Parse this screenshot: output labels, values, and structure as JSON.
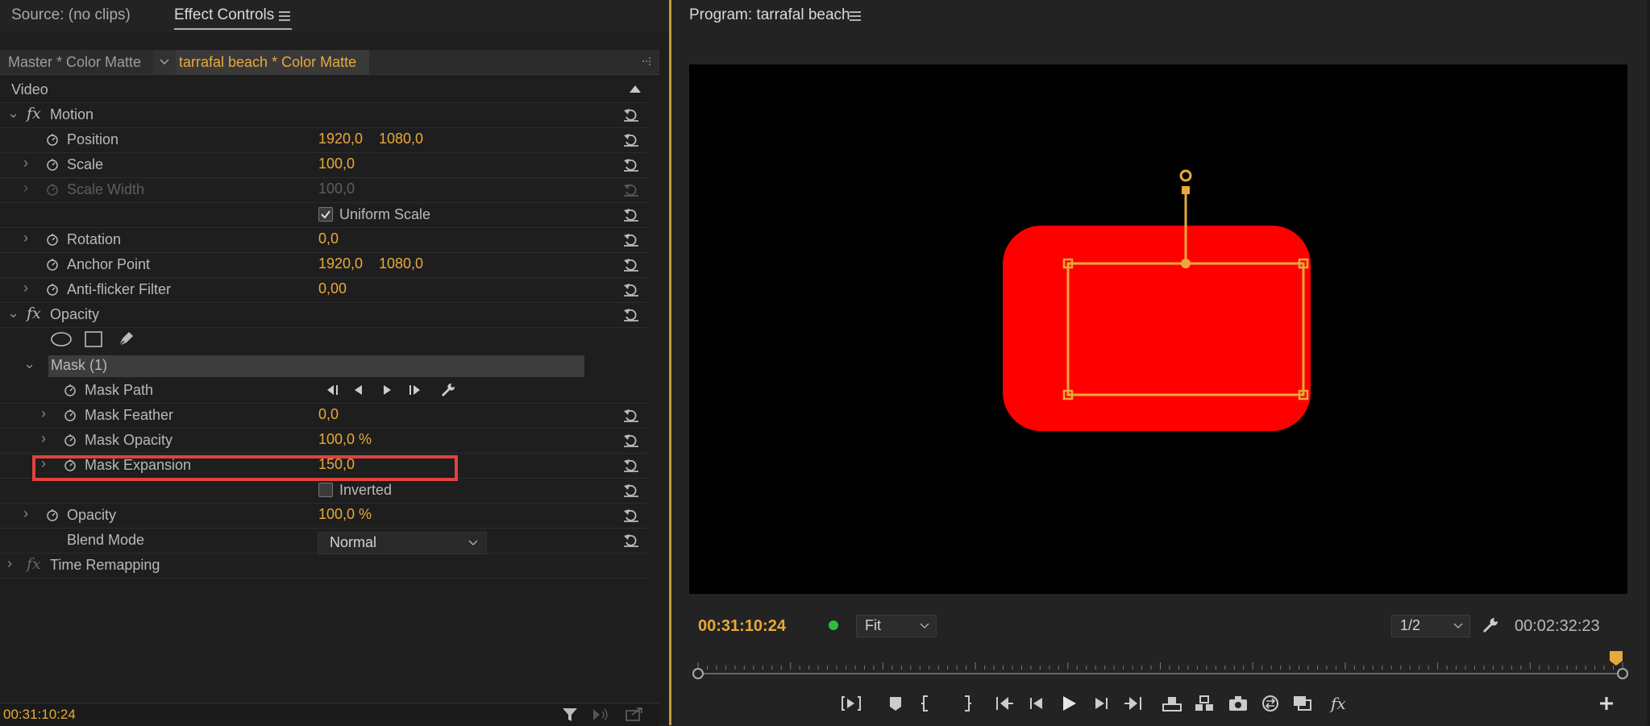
{
  "left_panel": {
    "tabs": {
      "source": "Source: (no clips)",
      "effect_controls": "Effect Controls"
    },
    "clip_bar": {
      "master": "Master * Color Matte",
      "active_clip": "tarrafal beach * Color Matte"
    },
    "section_label": "Video",
    "rows": {
      "motion": "Motion",
      "position": {
        "label": "Position",
        "x": "1920,0",
        "y": "1080,0"
      },
      "scale": {
        "label": "Scale",
        "value": "100,0"
      },
      "scale_width": {
        "label": "Scale Width",
        "value": "100,0"
      },
      "uniform_scale": {
        "label": "Uniform Scale",
        "checked": true
      },
      "rotation": {
        "label": "Rotation",
        "value": "0,0"
      },
      "anchor_point": {
        "label": "Anchor Point",
        "x": "1920,0",
        "y": "1080,0"
      },
      "anti_flicker": {
        "label": "Anti-flicker Filter",
        "value": "0,00"
      },
      "opacity_group": "Opacity",
      "mask": "Mask (1)",
      "mask_path": "Mask Path",
      "mask_feather": {
        "label": "Mask Feather",
        "value": "0,0"
      },
      "mask_opacity": {
        "label": "Mask Opacity",
        "value": "100,0 %"
      },
      "mask_expansion": {
        "label": "Mask Expansion",
        "value": "150,0"
      },
      "inverted": {
        "label": "Inverted",
        "checked": false
      },
      "opacity": {
        "label": "Opacity",
        "value": "100,0 %"
      },
      "blend_mode": {
        "label": "Blend Mode",
        "value": "Normal"
      },
      "time_remapping": "Time Remapping"
    },
    "footer_timecode": "00:31:10:24"
  },
  "program_monitor": {
    "title": "Program: tarrafal beach",
    "current_timecode": "00:31:10:24",
    "duration_timecode": "00:02:32:23",
    "zoom": "Fit",
    "resolution": "1/2",
    "playhead_fraction": 0.993
  },
  "colors": {
    "accent": "#e8a93a",
    "matte_red": "#ff0000",
    "highlight": "#e1423d",
    "divider": "#c29a3d"
  }
}
